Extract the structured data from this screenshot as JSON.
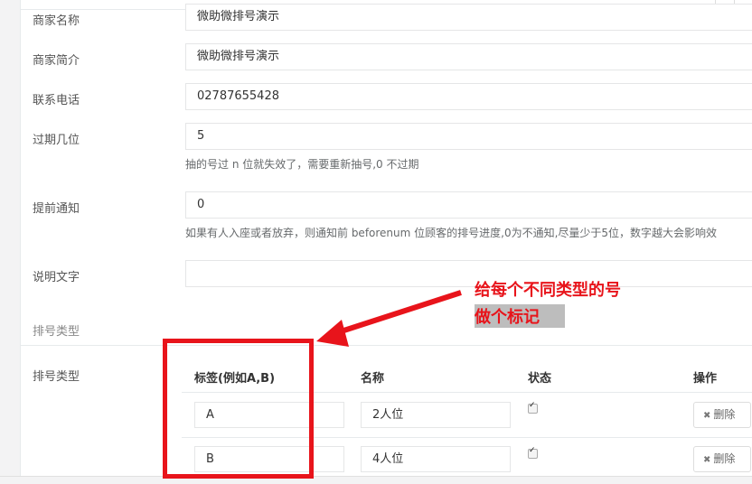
{
  "form": {
    "merchant_name_label": "商家名称",
    "merchant_name_value": "微助微排号演示",
    "merchant_intro_label": "商家简介",
    "merchant_intro_value": "微助微排号演示",
    "phone_label": "联系电话",
    "phone_value": "02787655428",
    "expire_label": "过期几位",
    "expire_value": "5",
    "expire_help": "抽的号过 n 位就失效了，需要重新抽号,0 不过期",
    "notify_label": "提前通知",
    "notify_value": "0",
    "notify_help": "如果有人入座或者放弃，则通知前 beforenum 位顾客的排号进度,0为不通知,尽量少于5位，数字越大会影响效",
    "desc_label": "说明文字",
    "desc_value": ""
  },
  "section": {
    "title": "排号类型"
  },
  "types": {
    "label": "排号类型",
    "headers": {
      "tag": "标签(例如A,B)",
      "name": "名称",
      "status": "状态",
      "action": "操作"
    },
    "rows": [
      {
        "tag": "A",
        "name": "2人位",
        "checked": true,
        "delete_label": "删除"
      },
      {
        "tag": "B",
        "name": "4人位",
        "checked": true,
        "delete_label": "删除"
      }
    ]
  },
  "annotation": {
    "line1": "给每个不同类型的号",
    "line2": "做个标记"
  },
  "colors": {
    "annotation_red": "#e8141b"
  }
}
